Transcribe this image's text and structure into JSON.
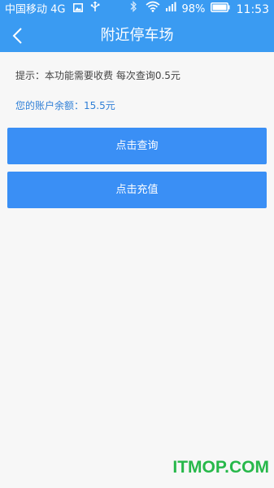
{
  "status_bar": {
    "carrier": "中国移动",
    "network": "4G",
    "battery_level": "98%",
    "time": "11:53",
    "icons": [
      "image-icon",
      "usb-icon",
      "bluetooth-icon",
      "wifi-icon",
      "signal-icon",
      "battery-icon"
    ]
  },
  "header": {
    "title": "附近停车场",
    "back_icon": "chevron-left-icon"
  },
  "content": {
    "hint": "提示：本功能需要收费 每次查询0.5元",
    "balance": "您的账户余额：15.5元"
  },
  "buttons": {
    "query": "点击查询",
    "recharge": "点击充值"
  },
  "watermark": "ITMOP.COM",
  "colors": {
    "header": "#3a9bf2",
    "button": "#3a8ff5",
    "balance_text": "#2f7fd6",
    "watermark": "#27b84a",
    "background": "#f7f7f7"
  }
}
